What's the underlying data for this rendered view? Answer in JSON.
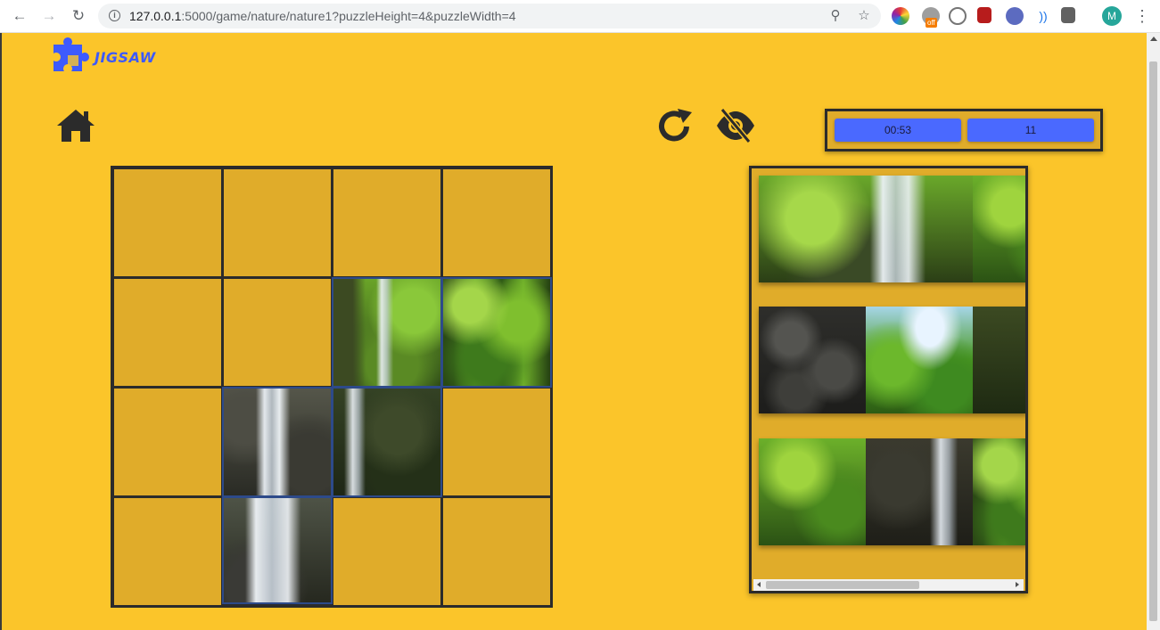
{
  "browser": {
    "url_host": "127.0.0.1",
    "url_rest": ":5000/game/nature/nature1?puzzleHeight=4&puzzleWidth=4",
    "profile_initial": "M",
    "extension_badge": "off"
  },
  "app": {
    "logo_text": "JIGSAW",
    "accent_color": "#3d5afe",
    "background_color": "#fbc52a"
  },
  "toolbar": {
    "home_icon": "home-icon",
    "restart_icon": "redo-icon",
    "hide_preview_icon": "eye-slash-icon"
  },
  "stats": {
    "timer": "00:53",
    "moves": "11"
  },
  "board": {
    "rows": 4,
    "cols": 4,
    "placed": [
      {
        "row": 1,
        "col": 2,
        "image": "forest waterfall top-left"
      },
      {
        "row": 1,
        "col": 3,
        "image": "sunlit forest"
      },
      {
        "row": 2,
        "col": 1,
        "image": "waterfall middle"
      },
      {
        "row": 2,
        "col": 2,
        "image": "waterfall right side"
      },
      {
        "row": 3,
        "col": 1,
        "image": "waterfall bottom"
      }
    ]
  },
  "tray": {
    "rows": [
      {
        "pieces": [
          "waterfall top",
          "forest edge"
        ]
      },
      {
        "pieces": [
          "dark rocks",
          "sky and trees",
          "forest edge"
        ]
      },
      {
        "pieces": [
          "green forest",
          "dark waterfall",
          "forest edge"
        ]
      }
    ]
  }
}
